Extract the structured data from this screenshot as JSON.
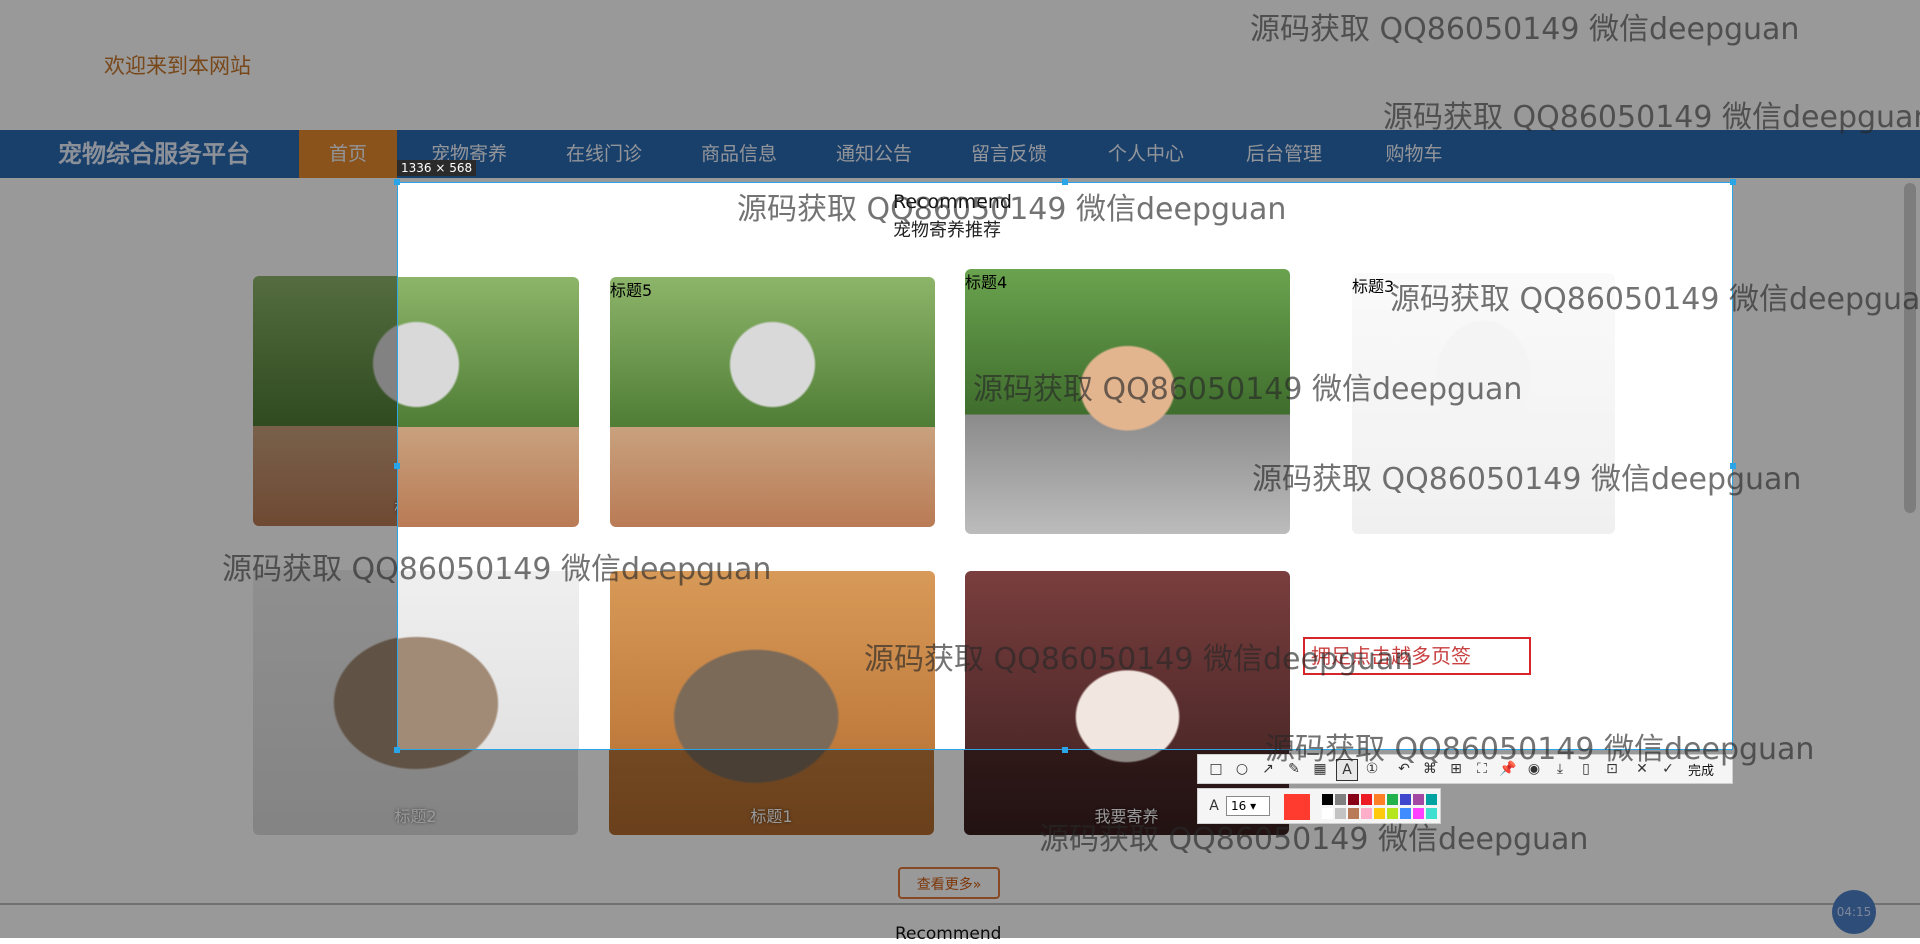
{
  "header": {
    "welcome": "欢迎来到本网站"
  },
  "nav": {
    "brand": "宠物综合服务平台",
    "items": [
      "首页",
      "宠物寄养",
      "在线门诊",
      "商品信息",
      "通知公告",
      "留言反馈",
      "个人中心",
      "后台管理",
      "购物车"
    ],
    "active_index": 0
  },
  "section": {
    "title": "Recommend",
    "subtitle": "宠物寄养推荐"
  },
  "cards": [
    {
      "caption": "标题6",
      "photo": "jumping-dog"
    },
    {
      "caption": "标题5",
      "photo": "jumping-dog"
    },
    {
      "caption": "标题4",
      "photo": "poodle-on-stones"
    },
    {
      "caption": "标题3",
      "photo": "white-dog-in-dress"
    },
    {
      "caption": "标题2",
      "photo": "fluffy-cat"
    },
    {
      "caption": "标题1",
      "photo": "tabby-cat"
    },
    {
      "caption": "我要寄养",
      "photo": "woman-portrait"
    }
  ],
  "more_button": "查看更多»",
  "bottom": {
    "recommend": "Recommend"
  },
  "time_badge": "04:15",
  "screenshot_tool": {
    "size_label": "1336 × 568",
    "text_annotation": "拥足点击越多页签",
    "done_label": "完成",
    "font_size": "16",
    "current_color": "#ff3b30",
    "palette": [
      "#000000",
      "#7f7f7f",
      "#880015",
      "#ed1c24",
      "#ff7f27",
      "#22b14c",
      "#3f48cc",
      "#a349a4",
      "#00a2a2",
      "#ffffff",
      "#c3c3c3",
      "#b97a57",
      "#ffaec9",
      "#ffc90e",
      "#b5e61d",
      "#3f8cff",
      "#ff40ff",
      "#40e0d0"
    ]
  },
  "watermark_text": "源码获取 QQ86050149 微信deepguan"
}
